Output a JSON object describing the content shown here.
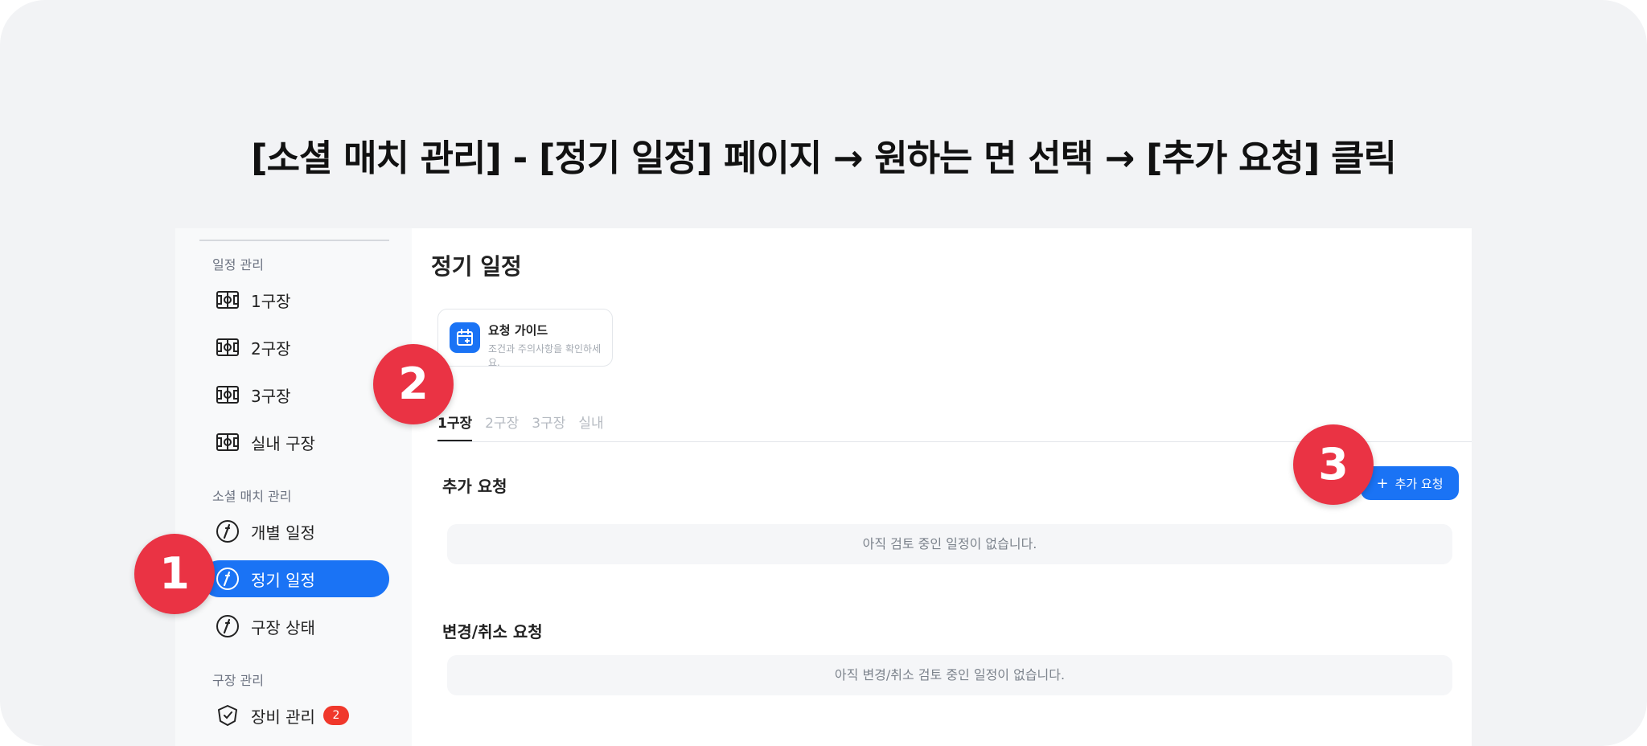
{
  "headline": "[소셜 매치 관리] - [정기 일정] 페이지 → 원하는 면 선택 → [추가 요청] 클릭",
  "sidebar": {
    "sections": [
      {
        "title": "일정 관리"
      },
      {
        "title": "소셜 매치 관리"
      },
      {
        "title": "구장 관리"
      }
    ],
    "items": [
      {
        "label": "1구장",
        "icon": "stadium-icon"
      },
      {
        "label": "2구장",
        "icon": "stadium-icon"
      },
      {
        "label": "3구장",
        "icon": "stadium-icon"
      },
      {
        "label": "실내 구장",
        "icon": "stadium-icon"
      },
      {
        "label": "개별 일정",
        "icon": "match-icon"
      },
      {
        "label": "정기 일정",
        "icon": "match-icon",
        "active": true
      },
      {
        "label": "구장 상태",
        "icon": "match-icon"
      },
      {
        "label": "장비 관리",
        "icon": "equipment-icon",
        "badge": "2"
      }
    ]
  },
  "main": {
    "title": "정기 일정",
    "guide": {
      "title": "요청 가이드",
      "subtitle": "조건과 주의사항을 확인하세요.",
      "icon": "calendar-plus-icon"
    },
    "tabs": [
      {
        "label": "1구장",
        "active": true
      },
      {
        "label": "2구장"
      },
      {
        "label": "3구장"
      },
      {
        "label": "실내"
      }
    ],
    "add_section": {
      "title": "추가 요청",
      "button_label": "추가 요청",
      "button_icon": "+",
      "empty_text": "아직 검토 중인 일정이 없습니다."
    },
    "change_section": {
      "title": "변경/취소 요청",
      "empty_text": "아직 변경/취소 검토 중인 일정이 없습니다."
    }
  },
  "steps": [
    "1",
    "2",
    "3"
  ],
  "colors": {
    "accent": "#1a73f5",
    "step_marker": "#ea3344",
    "badge": "#f0382b",
    "backdrop": "#f2f3f5"
  }
}
